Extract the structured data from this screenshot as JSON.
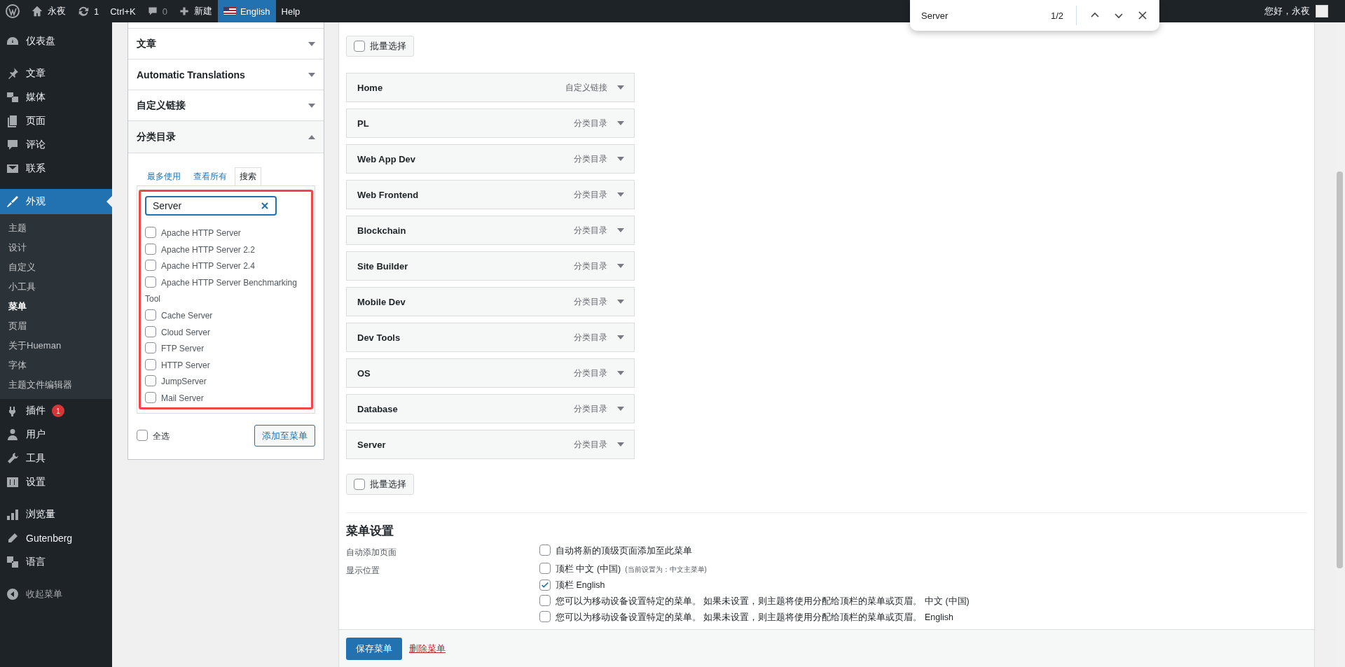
{
  "admin_bar": {
    "items": [
      {
        "kind": "logo"
      },
      {
        "kind": "home",
        "label": "永夜"
      },
      {
        "kind": "updates",
        "label": "1"
      },
      {
        "kind": "text",
        "label": "Ctrl+K"
      },
      {
        "kind": "comments",
        "label": "0"
      },
      {
        "kind": "new",
        "label": "新建"
      },
      {
        "kind": "language",
        "label": "English"
      },
      {
        "kind": "text",
        "label": "Help"
      }
    ],
    "greeting": "您好，永夜"
  },
  "find_bar": {
    "query": "Server",
    "count": "1/2"
  },
  "sidebar": {
    "groups": [
      [
        {
          "label": "仪表盘",
          "selected": false
        }
      ],
      [
        {
          "label": "文章",
          "selected": false
        },
        {
          "label": "媒体",
          "selected": false
        },
        {
          "label": "页面",
          "selected": false
        },
        {
          "label": "评论",
          "selected": false
        },
        {
          "label": "联系",
          "selected": false
        }
      ],
      [
        {
          "label": "外观",
          "selected": true,
          "children": [
            {
              "label": "主题",
              "selected": false
            },
            {
              "label": "设计",
              "selected": false
            },
            {
              "label": "自定义",
              "selected": false
            },
            {
              "label": "小工具",
              "selected": false
            },
            {
              "label": "菜单",
              "selected": true
            },
            {
              "label": "页眉",
              "selected": false
            },
            {
              "label": "关于Hueman",
              "selected": false
            },
            {
              "label": "字体",
              "selected": false
            },
            {
              "label": "主题文件编辑器",
              "selected": false
            }
          ]
        },
        {
          "label": "插件",
          "selected": false,
          "badge": "1"
        },
        {
          "label": "用户",
          "selected": false
        },
        {
          "label": "工具",
          "selected": false
        },
        {
          "label": "设置",
          "selected": false
        }
      ],
      [
        {
          "label": "浏览量",
          "selected": false
        },
        {
          "label": "Gutenberg",
          "selected": false
        },
        {
          "label": "语言",
          "selected": false
        }
      ]
    ],
    "collapse": "收起菜单"
  },
  "add_items": {
    "sections": [
      {
        "title": "文章",
        "expanded": false
      },
      {
        "title": "Automatic Translations",
        "expanded": false
      },
      {
        "title": "自定义链接",
        "expanded": false
      },
      {
        "title": "分类目录",
        "expanded": true,
        "tabs": [
          {
            "label": "最多使用",
            "selected": false
          },
          {
            "label": "查看所有",
            "selected": false
          },
          {
            "label": "搜索",
            "selected": true
          }
        ],
        "search": {
          "value": "Server"
        },
        "options": [
          {
            "label": "Apache HTTP Server",
            "checked": false
          },
          {
            "label": "Apache HTTP Server 2.2",
            "checked": false
          },
          {
            "label": "Apache HTTP Server 2.4",
            "checked": false
          },
          {
            "label": "Apache HTTP Server Benchmarking Tool",
            "checked": false
          },
          {
            "label": "Cache Server",
            "checked": false
          },
          {
            "label": "Cloud Server",
            "checked": false
          },
          {
            "label": "FTP Server",
            "checked": false
          },
          {
            "label": "HTTP Server",
            "checked": false
          },
          {
            "label": "JumpServer",
            "checked": false
          },
          {
            "label": "Mail Server",
            "checked": false
          }
        ],
        "select_all": {
          "label": "全选",
          "checked": false
        },
        "add_button": "添加至菜单"
      }
    ]
  },
  "menu_structure": {
    "bulk_select_top": {
      "label": "批量选择",
      "checked": false
    },
    "items": [
      {
        "title": "Home",
        "type": "自定义链接"
      },
      {
        "title": "PL",
        "type": "分类目录"
      },
      {
        "title": "Web App Dev",
        "type": "分类目录"
      },
      {
        "title": "Web Frontend",
        "type": "分类目录"
      },
      {
        "title": "Blockchain",
        "type": "分类目录"
      },
      {
        "title": "Site Builder",
        "type": "分类目录"
      },
      {
        "title": "Mobile Dev",
        "type": "分类目录"
      },
      {
        "title": "Dev Tools",
        "type": "分类目录"
      },
      {
        "title": "OS",
        "type": "分类目录"
      },
      {
        "title": "Database",
        "type": "分类目录"
      },
      {
        "title": "Server",
        "type": "分类目录"
      }
    ],
    "bulk_select_bottom": {
      "label": "批量选择",
      "checked": false
    }
  },
  "menu_settings": {
    "heading": "菜单设置",
    "auto_add": {
      "label": "自动添加页面",
      "option": {
        "label": "自动将新的顶级页面添加至此菜单",
        "checked": false
      }
    },
    "locations": {
      "label": "显示位置",
      "options": [
        {
          "label": "顶栏 中文 (中国)",
          "note": "(当前设置为：中文主菜单)",
          "checked": false
        },
        {
          "label": "顶栏 English",
          "checked": true
        },
        {
          "label": "您可以为移动设备设置特定的菜单。 如果未设置，则主题将使用分配给顶栏的菜单或页眉。 中文 (中国)",
          "checked": false
        },
        {
          "label": "您可以为移动设备设置特定的菜单。 如果未设置，则主题将使用分配给顶栏的菜单或页眉。 English",
          "checked": false
        }
      ]
    }
  },
  "footer": {
    "save": "保存菜单",
    "delete": "删除菜单"
  }
}
